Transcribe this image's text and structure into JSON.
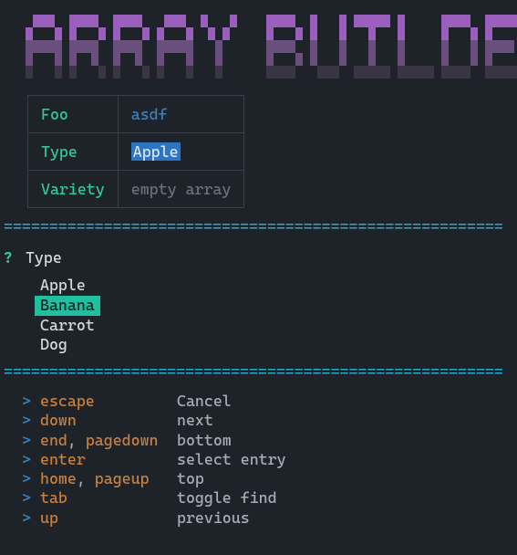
{
  "title_text": "ARRAY BUILDER",
  "table": {
    "rows": [
      {
        "key": "Foo",
        "value": "asdf",
        "style": "blue"
      },
      {
        "key": "Type",
        "value": "Apple",
        "style": "selected"
      },
      {
        "key": "Variety",
        "value": "empty array",
        "style": "dim"
      }
    ]
  },
  "divider": "=======================================================",
  "prompt": {
    "marker": "?",
    "label": "Type"
  },
  "options": [
    {
      "label": "Apple",
      "highlighted": false
    },
    {
      "label": "Banana",
      "highlighted": true
    },
    {
      "label": "Carrot",
      "highlighted": false
    },
    {
      "label": "Dog",
      "highlighted": false
    }
  ],
  "legend": [
    {
      "keys": [
        "escape"
      ],
      "desc": "Cancel"
    },
    {
      "keys": [
        "down"
      ],
      "desc": "next"
    },
    {
      "keys": [
        "end",
        "pagedown"
      ],
      "desc": "bottom"
    },
    {
      "keys": [
        "enter"
      ],
      "desc": "select entry"
    },
    {
      "keys": [
        "home",
        "pageup"
      ],
      "desc": "top"
    },
    {
      "keys": [
        "tab"
      ],
      "desc": "toggle find"
    },
    {
      "keys": [
        "up"
      ],
      "desc": "previous"
    }
  ],
  "legend_chevron": ">",
  "legend_sep": ", "
}
